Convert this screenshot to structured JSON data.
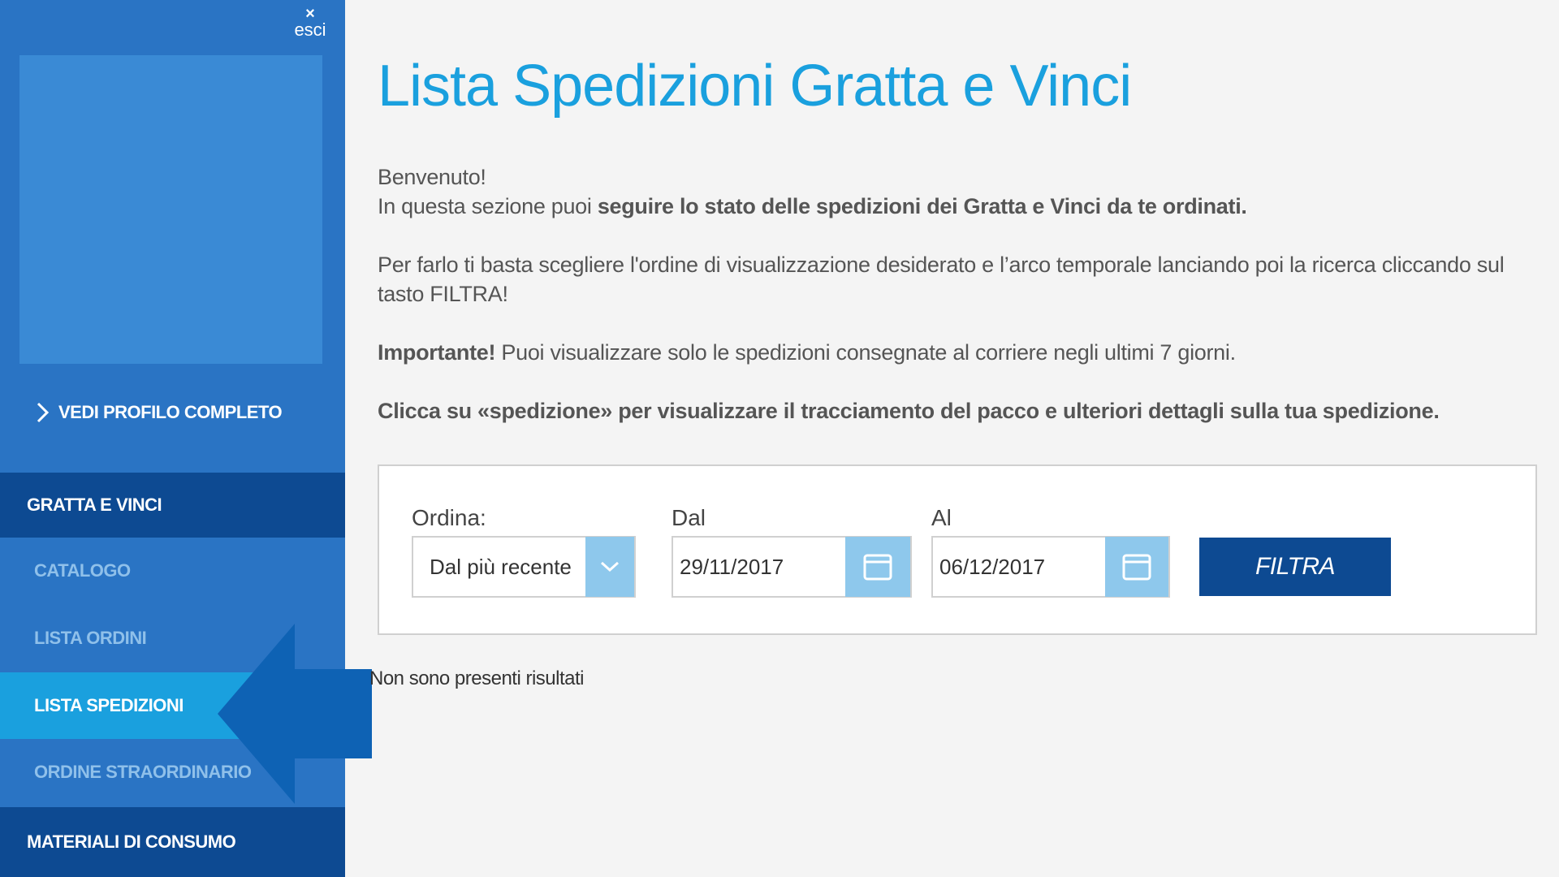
{
  "sidebar": {
    "logout_icon": "×",
    "logout_label": "esci",
    "profile_link": "VEDI PROFILO COMPLETO",
    "section_gratta": "GRATTA E VINCI",
    "items": [
      {
        "label": "CATALOGO"
      },
      {
        "label": "LISTA ORDINI"
      },
      {
        "label": "LISTA SPEDIZIONI",
        "active": true
      },
      {
        "label": "ORDINE STRAORDINARIO"
      }
    ],
    "section_materiali": "MATERIALI DI CONSUMO"
  },
  "main": {
    "title": "Lista Spedizioni Gratta e Vinci",
    "welcome": "Benvenuto!",
    "intro_prefix": "In questa sezione puoi ",
    "intro_bold": "seguire lo stato delle spedizioni dei Gratta e Vinci da te ordinati.",
    "instructions": "Per farlo ti basta scegliere l'ordine di visualizzazione desiderato e l’arco temporale lanciando poi la ricerca cliccando sul tasto FILTRA!",
    "important_bold": "Importante!",
    "important_text": " Puoi visualizzare solo le spedizioni consegnate al corriere negli ultimi 7 giorni.",
    "click_hint": "Clicca su «spedizione» per visualizzare il tracciamento del pacco e ulteriori dettagli sulla tua spedizione."
  },
  "filter": {
    "order_label": "Ordina:",
    "order_value": "Dal più recente",
    "from_label": "Dal",
    "from_value": "29/11/2017",
    "to_label": "Al",
    "to_value": "06/12/2017",
    "button_label": "FILTRA"
  },
  "results": {
    "empty_message": "Non sono presenti risultati"
  },
  "colors": {
    "sidebar_bg": "#2a74c4",
    "sidebar_dark": "#0d4a92",
    "active_item": "#1aa0de",
    "title_blue": "#1aa0de",
    "control_blue": "#8ec8ec"
  }
}
